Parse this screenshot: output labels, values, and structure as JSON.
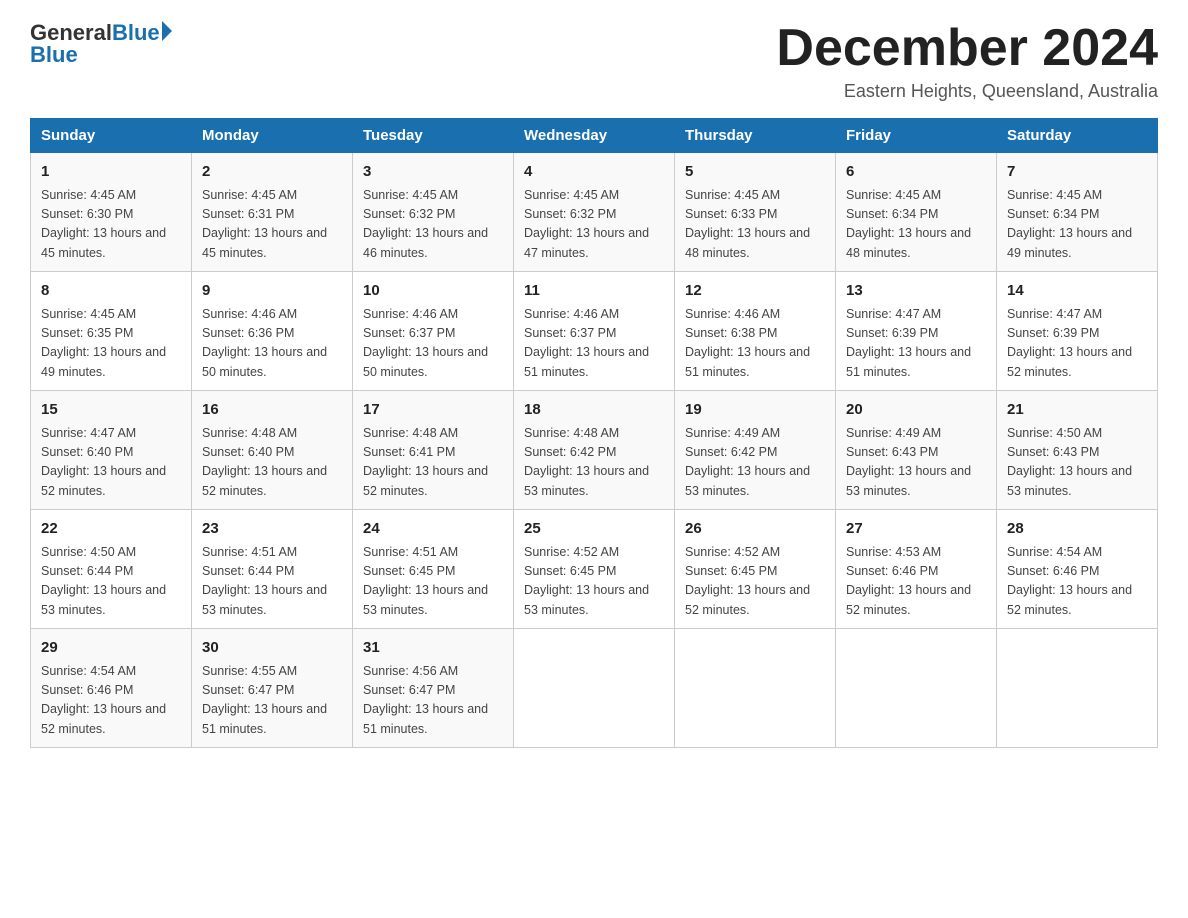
{
  "header": {
    "logo_general": "General",
    "logo_blue": "Blue",
    "month_title": "December 2024",
    "location": "Eastern Heights, Queensland, Australia"
  },
  "days_of_week": [
    "Sunday",
    "Monday",
    "Tuesday",
    "Wednesday",
    "Thursday",
    "Friday",
    "Saturday"
  ],
  "weeks": [
    [
      {
        "day": "1",
        "sunrise": "4:45 AM",
        "sunset": "6:30 PM",
        "daylight": "13 hours and 45 minutes."
      },
      {
        "day": "2",
        "sunrise": "4:45 AM",
        "sunset": "6:31 PM",
        "daylight": "13 hours and 45 minutes."
      },
      {
        "day": "3",
        "sunrise": "4:45 AM",
        "sunset": "6:32 PM",
        "daylight": "13 hours and 46 minutes."
      },
      {
        "day": "4",
        "sunrise": "4:45 AM",
        "sunset": "6:32 PM",
        "daylight": "13 hours and 47 minutes."
      },
      {
        "day": "5",
        "sunrise": "4:45 AM",
        "sunset": "6:33 PM",
        "daylight": "13 hours and 48 minutes."
      },
      {
        "day": "6",
        "sunrise": "4:45 AM",
        "sunset": "6:34 PM",
        "daylight": "13 hours and 48 minutes."
      },
      {
        "day": "7",
        "sunrise": "4:45 AM",
        "sunset": "6:34 PM",
        "daylight": "13 hours and 49 minutes."
      }
    ],
    [
      {
        "day": "8",
        "sunrise": "4:45 AM",
        "sunset": "6:35 PM",
        "daylight": "13 hours and 49 minutes."
      },
      {
        "day": "9",
        "sunrise": "4:46 AM",
        "sunset": "6:36 PM",
        "daylight": "13 hours and 50 minutes."
      },
      {
        "day": "10",
        "sunrise": "4:46 AM",
        "sunset": "6:37 PM",
        "daylight": "13 hours and 50 minutes."
      },
      {
        "day": "11",
        "sunrise": "4:46 AM",
        "sunset": "6:37 PM",
        "daylight": "13 hours and 51 minutes."
      },
      {
        "day": "12",
        "sunrise": "4:46 AM",
        "sunset": "6:38 PM",
        "daylight": "13 hours and 51 minutes."
      },
      {
        "day": "13",
        "sunrise": "4:47 AM",
        "sunset": "6:39 PM",
        "daylight": "13 hours and 51 minutes."
      },
      {
        "day": "14",
        "sunrise": "4:47 AM",
        "sunset": "6:39 PM",
        "daylight": "13 hours and 52 minutes."
      }
    ],
    [
      {
        "day": "15",
        "sunrise": "4:47 AM",
        "sunset": "6:40 PM",
        "daylight": "13 hours and 52 minutes."
      },
      {
        "day": "16",
        "sunrise": "4:48 AM",
        "sunset": "6:40 PM",
        "daylight": "13 hours and 52 minutes."
      },
      {
        "day": "17",
        "sunrise": "4:48 AM",
        "sunset": "6:41 PM",
        "daylight": "13 hours and 52 minutes."
      },
      {
        "day": "18",
        "sunrise": "4:48 AM",
        "sunset": "6:42 PM",
        "daylight": "13 hours and 53 minutes."
      },
      {
        "day": "19",
        "sunrise": "4:49 AM",
        "sunset": "6:42 PM",
        "daylight": "13 hours and 53 minutes."
      },
      {
        "day": "20",
        "sunrise": "4:49 AM",
        "sunset": "6:43 PM",
        "daylight": "13 hours and 53 minutes."
      },
      {
        "day": "21",
        "sunrise": "4:50 AM",
        "sunset": "6:43 PM",
        "daylight": "13 hours and 53 minutes."
      }
    ],
    [
      {
        "day": "22",
        "sunrise": "4:50 AM",
        "sunset": "6:44 PM",
        "daylight": "13 hours and 53 minutes."
      },
      {
        "day": "23",
        "sunrise": "4:51 AM",
        "sunset": "6:44 PM",
        "daylight": "13 hours and 53 minutes."
      },
      {
        "day": "24",
        "sunrise": "4:51 AM",
        "sunset": "6:45 PM",
        "daylight": "13 hours and 53 minutes."
      },
      {
        "day": "25",
        "sunrise": "4:52 AM",
        "sunset": "6:45 PM",
        "daylight": "13 hours and 53 minutes."
      },
      {
        "day": "26",
        "sunrise": "4:52 AM",
        "sunset": "6:45 PM",
        "daylight": "13 hours and 52 minutes."
      },
      {
        "day": "27",
        "sunrise": "4:53 AM",
        "sunset": "6:46 PM",
        "daylight": "13 hours and 52 minutes."
      },
      {
        "day": "28",
        "sunrise": "4:54 AM",
        "sunset": "6:46 PM",
        "daylight": "13 hours and 52 minutes."
      }
    ],
    [
      {
        "day": "29",
        "sunrise": "4:54 AM",
        "sunset": "6:46 PM",
        "daylight": "13 hours and 52 minutes."
      },
      {
        "day": "30",
        "sunrise": "4:55 AM",
        "sunset": "6:47 PM",
        "daylight": "13 hours and 51 minutes."
      },
      {
        "day": "31",
        "sunrise": "4:56 AM",
        "sunset": "6:47 PM",
        "daylight": "13 hours and 51 minutes."
      },
      null,
      null,
      null,
      null
    ]
  ]
}
